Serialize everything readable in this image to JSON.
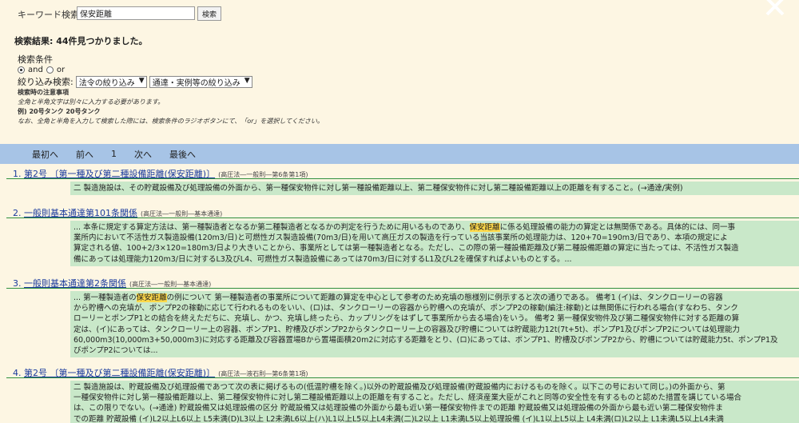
{
  "search": {
    "label": "キーワード検索:",
    "value": "保安距離",
    "button": "検索"
  },
  "results_summary": "検索結果: 44件見つかりました。",
  "conditions": {
    "title": "検索条件",
    "radio_and": "and",
    "radio_or": "or",
    "filter_label": "絞り込み検索:",
    "filter_law": "法令の絞り込み",
    "filter_notice": "通達・実例等の絞り込み"
  },
  "notes": {
    "title": "検索時の注意事項",
    "line1": "全角と半角文字は別々に入力する必要があります。",
    "line2": "例) 20号タンク 20号タンク",
    "line3": "なお、全角と半角を入力して検索した際には、検索条件のラジオボタンにて、「or」を選択してください。"
  },
  "pagination": {
    "first": "最初へ",
    "prev": "前へ",
    "page": "1",
    "next": "次へ",
    "last": "最後へ"
  },
  "results": [
    {
      "number": "1.",
      "title": "第2号 〔第一種及び第二種設備距離(保安距離)〕",
      "source": "(高圧法―一般則―第6条第1項)",
      "lines": [
        [
          "二 製造施設は、その貯蔵設備及び処理設備の外面から、第一種保安物件に対し第一種設備距離以上、第二種保安物件に対し第二種設備距離以上の距離を有すること。(→通達/実例)"
        ]
      ]
    },
    {
      "number": "2.",
      "title": "一般則基本通達第101条関係",
      "source": "(高圧法―一般則―基本通達)",
      "lines": [
        [
          "... 本条に規定する算定方法は、第一種製造者となるか第二種製造者となるかの判定を行うために用いるものであり、",
          "保安距離",
          "に係る処理設備の能力の算定とは無関係である。具体的には、同一事"
        ],
        [
          "業所内において不活性ガス製造設備(120m3/日)と可燃性ガス製造設備(70m3/日)を用いて高圧ガスの製造を行っている当該事業所の処理能力は、120+70=190m3/日であり、本項の規定によ"
        ],
        [
          "算定される値、100+2/3×120=180m3/日より大きいことから、事業所としては第一種製造者となる。ただし、この際の第一種設備距離及び第二種設備距離の算定に当たっては、不活性ガス製造"
        ],
        [
          "備にあっては処理能力120m3/日に対するL3及びL4、可燃性ガス製造設備にあっては70m3/日に対するL1及びL2を確保すればよいものとする。..."
        ]
      ]
    },
    {
      "number": "3.",
      "title": "一般則基本通達第2条関係",
      "source": "(高圧法―一般則―基本通達)",
      "lines": [
        [
          "... 第一種製造者の",
          "保安距離",
          "の例について 第一種製造者の事業所について距離の算定を中心として参考のため充填の態様別に例示すると次の通りである。 備考1 (イ)は、タンクローリーの容器"
        ],
        [
          "から貯槽への充填が、ポンプP2の稼動に応じて行われるものをいい、(ロ)は、タンクローリーの容器から貯槽への充填が、ポンプP2の稼動(編注:稼動)とは無関係に行われる場合(すなわち、タンク"
        ],
        [
          "ローリーとポンプP1との結合を終えただちに、充填し、かつ、充填し終ったら、カップリングをはずして事業所から去る場合)をいう。 備考2 第一種保安物件及び第二種保安物件に対する距離の算"
        ],
        [
          "定は、(イ)にあっては、タンクローリー上の容器、ポンプP1、貯槽及びポンプP2からタンクローリー上の容器及び貯槽については貯蔵能力12t(7t+5t)、ポンプP1及びポンプP2については処理能力"
        ],
        [
          "60,000m3(10,000m3+50,000m3)に対応する距離及び容器置場Bから置場面積20m2に対応する距離をとり、(ロ)にあっては、ポンプP1、貯槽及びポンプP2から、貯槽については貯蔵能力5t、ポンプP1及"
        ],
        [
          "びポンプP2については..."
        ]
      ]
    },
    {
      "number": "4.",
      "title": "第2号 〔第一種及び第二種設備距離(保安距離)〕",
      "source": "(高圧法―液石則―第6条第1項)",
      "lines": [
        [
          "二 製造施設は、貯蔵設備及び処理設備であつて次の表に掲げるもの(低温貯槽を除く。)以外の貯蔵設備及び処理設備(貯蔵設備内におけるものを除く。以下この号において同じ。)の外面から、第"
        ],
        [
          "一種保安物件に対し第一種設備距離以上、第二種保安物件に対し第二種設備距離以上の距離を有すること。ただし、経済産業大臣がこれと同等の安全性を有するものと認めた措置を講じている場合"
        ],
        [
          "は、この限りでない。(→通達) 貯蔵設備又は処理設備の区分 貯蔵設備又は処理設備の外面から最も近い第一種保安物件までの距離 貯蔵設備又は処理設備の外面から最も近い第二種保安物件ま"
        ],
        [
          "での距離 貯蔵設備 (イ)L2以上L6以上 L5未満(D)L3以上 L2未満L6以上(ハ)L1以上L5以上L4未満(二)L2以上 L1未満L5以上処理設備 (イ)L1以上L5以上 L4未満(ロ)L2以上 L1未満L5以上L4未満"
        ]
      ]
    }
  ],
  "colors": {
    "page_bg": "#fdf6e3",
    "nav_bar": "#a7c4e6",
    "excerpt_bg": "#c9e8c9",
    "highlight": "#ffd94a",
    "title_link": "#1a3b9e",
    "rule": "#2f8f3e"
  }
}
